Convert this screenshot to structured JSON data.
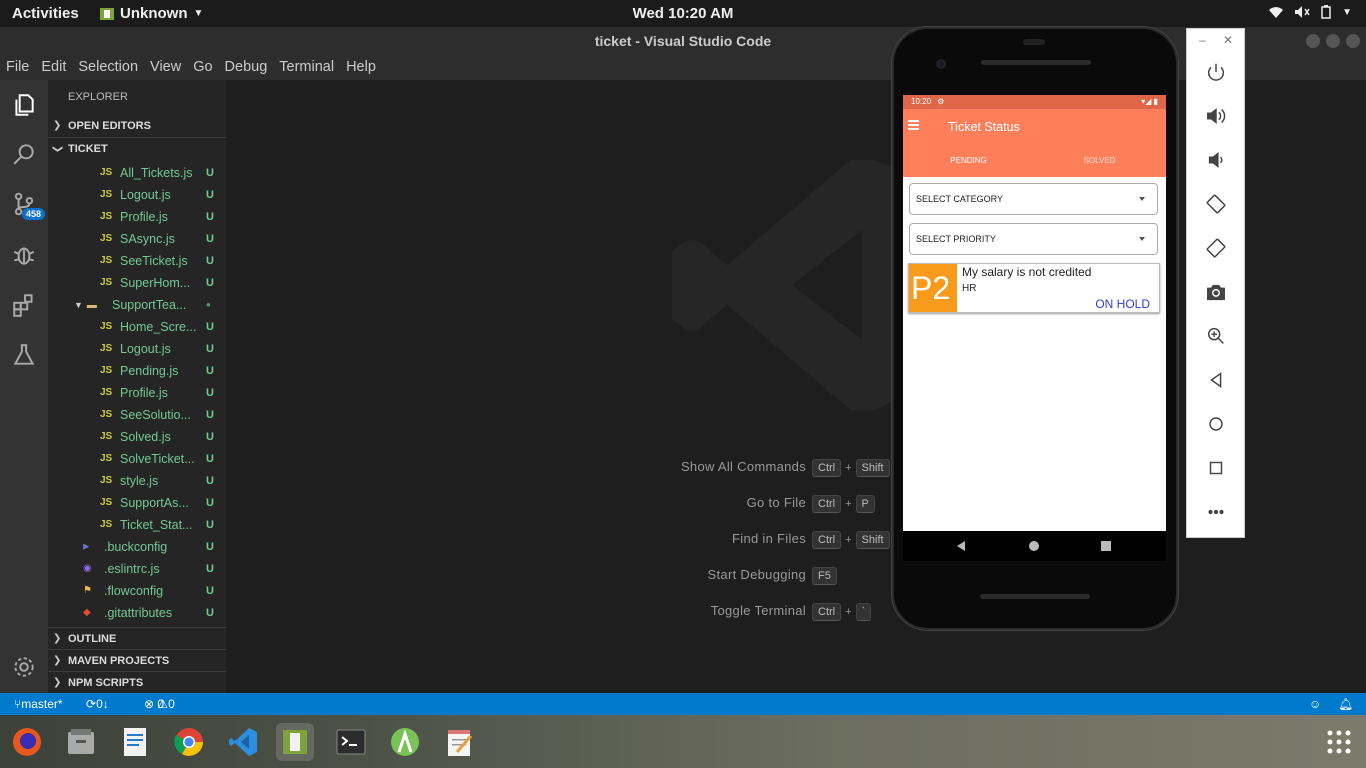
{
  "topbar": {
    "activities": "Activities",
    "app_name": "Unknown",
    "clock": "Wed 10:20 AM"
  },
  "window": {
    "title": "ticket - Visual Studio Code"
  },
  "menu": [
    "File",
    "Edit",
    "Selection",
    "View",
    "Go",
    "Debug",
    "Terminal",
    "Help"
  ],
  "activity_bar": {
    "scm_badge": "458"
  },
  "explorer": {
    "title": "EXPLORER",
    "open_editors": "OPEN EDITORS",
    "project": "TICKET",
    "files": [
      {
        "icon": "JS",
        "name": "All_Tickets.js",
        "status": "U"
      },
      {
        "icon": "JS",
        "name": "Logout.js",
        "status": "U"
      },
      {
        "icon": "JS",
        "name": "Profile.js",
        "status": "U"
      },
      {
        "icon": "JS",
        "name": "SAsync.js",
        "status": "U"
      },
      {
        "icon": "JS",
        "name": "SeeTicket.js",
        "status": "U"
      },
      {
        "icon": "JS",
        "name": "SuperHom...",
        "status": "U"
      },
      {
        "icon": "folder",
        "name": "SupportTea...",
        "status": "●"
      },
      {
        "icon": "JS",
        "name": "Home_Scre...",
        "status": "U"
      },
      {
        "icon": "JS",
        "name": "Logout.js",
        "status": "U"
      },
      {
        "icon": "JS",
        "name": "Pending.js",
        "status": "U"
      },
      {
        "icon": "JS",
        "name": "Profile.js",
        "status": "U"
      },
      {
        "icon": "JS",
        "name": "SeeSolutio...",
        "status": "U"
      },
      {
        "icon": "JS",
        "name": "Solved.js",
        "status": "U"
      },
      {
        "icon": "JS",
        "name": "SolveTicket...",
        "status": "U"
      },
      {
        "icon": "JS",
        "name": "style.js",
        "status": "U"
      },
      {
        "icon": "JS",
        "name": "SupportAs...",
        "status": "U"
      },
      {
        "icon": "JS",
        "name": "Ticket_Stat...",
        "status": "U"
      },
      {
        "icon": "buck",
        "name": ".buckconfig",
        "status": "U"
      },
      {
        "icon": "eslint",
        "name": ".eslintrc.js",
        "status": "U"
      },
      {
        "icon": "flow",
        "name": ".flowconfig",
        "status": "U"
      },
      {
        "icon": "git",
        "name": ".gitattributes",
        "status": "U"
      }
    ],
    "outline": "OUTLINE",
    "maven": "MAVEN PROJECTS",
    "npm": "NPM SCRIPTS"
  },
  "welcome_commands": [
    {
      "label": "Show All Commands",
      "keys": [
        "Ctrl",
        "Shift"
      ]
    },
    {
      "label": "Go to File",
      "keys": [
        "Ctrl",
        "P"
      ]
    },
    {
      "label": "Find in Files",
      "keys": [
        "Ctrl",
        "Shift"
      ]
    },
    {
      "label": "Start Debugging",
      "keys": [
        "F5"
      ]
    },
    {
      "label": "Toggle Terminal",
      "keys": [
        "Ctrl",
        "`"
      ]
    }
  ],
  "statusbar": {
    "branch": "master*",
    "sync": "0↓ 1↑",
    "errors": "0",
    "warnings": "0"
  },
  "phone": {
    "time": "10:20",
    "app_title": "Ticket Status",
    "tabs": [
      "PENDING",
      "SOLVED"
    ],
    "category_placeholder": "SELECT CATEGORY",
    "priority_placeholder": "SELECT PRIORITY",
    "ticket": {
      "priority": "P2",
      "title": "My salary is not credited",
      "department": "HR",
      "status": "ON HOLD"
    }
  },
  "colors": {
    "accent": "#ff7f5a",
    "statusbar": "#007acc",
    "priority_badge": "#f89a1b",
    "status_text": "#2b3ee0"
  }
}
